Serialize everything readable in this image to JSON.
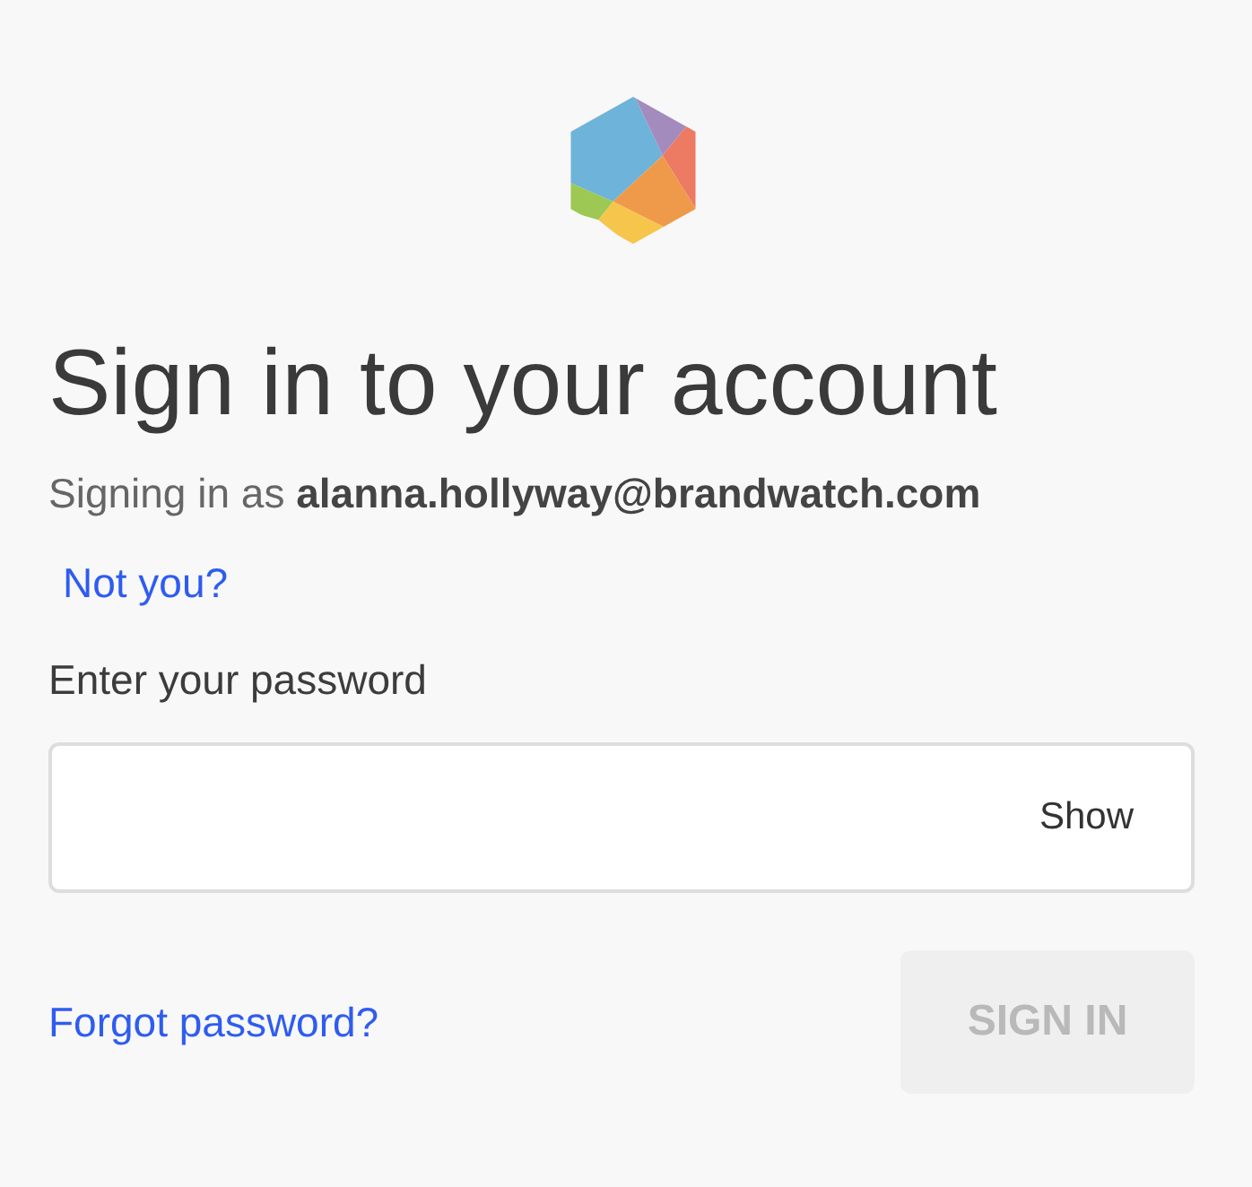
{
  "heading": "Sign in to your account",
  "signing_in": "Signing in as **alanna.hollyway@brandwatch.com**",
  "not_you_link": "Not you?",
  "password": {
    "label": "Enter your password",
    "show_toggle": "Show"
  },
  "forgot_link": "Forgot password?",
  "sign_in_button": {
    "label": "SIGN IN",
    "disabled": true
  }
}
